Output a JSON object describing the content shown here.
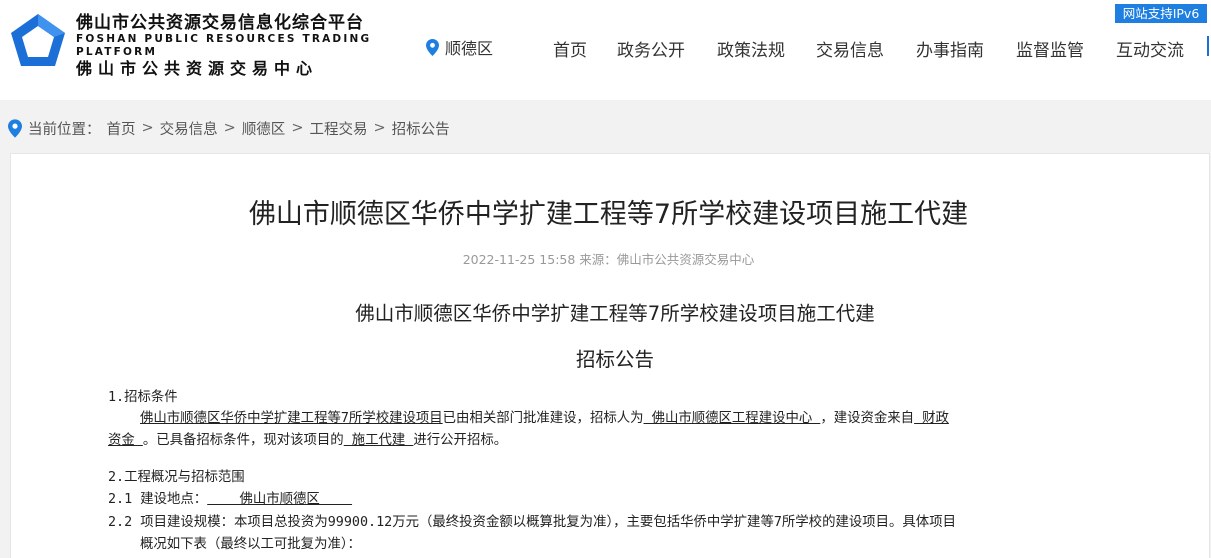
{
  "header": {
    "logo_line1": "佛山市公共资源交易信息化综合平台",
    "logo_line2": "FOSHAN PUBLIC RESOURCES TRADING PLATFORM",
    "logo_line3": "佛山市公共资源交易中心",
    "location": "顺德区",
    "ipv6_badge": "网站支持IPv6",
    "nav": [
      "首页",
      "政务公开",
      "政策法规",
      "交易信息",
      "办事指南",
      "监督监管",
      "互动交流"
    ],
    "colors": {
      "brand": "#1f7fe0",
      "logo": "#1b6fd6"
    }
  },
  "breadcrumb": {
    "prefix": "当前位置：",
    "items": [
      "首页",
      "交易信息",
      "顺德区",
      "工程交易",
      "招标公告"
    ]
  },
  "article": {
    "title": "佛山市顺德区华侨中学扩建工程等7所学校建设项目施工代建",
    "meta": "2022-11-25 15:58 来源：佛山市公共资源交易中心",
    "subtitle": "佛山市顺德区华侨中学扩建工程等7所学校建设项目施工代建",
    "subtitle2": "招标公告",
    "s1_heading": "1.招标条件",
    "s1_l1_a": "佛山市顺德区华侨中学扩建工程等7所学校建设项目",
    "s1_l1_b": "已由相关部门批准建设，招标人为",
    "s1_l1_c": " 佛山市顺德区工程建设中心 ",
    "s1_l1_d": "，建设资金来自",
    "s1_l1_e": " 财政",
    "s1_l2_a": "资金 ",
    "s1_l2_b": "。已具备招标条件，现对该项目的",
    "s1_l2_c": " 施工代建 ",
    "s1_l2_d": "进行公开招标。",
    "s2_heading": "2.工程概况与招标范围",
    "s21_label": "2.1 建设地点：",
    "s21_value": "    佛山市顺德区    ",
    "s22_l1": "2.2 项目建设规模：本项目总投资为99900.12万元（最终投资金额以概算批复为准），主要包括华侨中学扩建等7所学校的建设项目。具体项目",
    "s22_l2": "概况如下表（最终以工可批复为准）："
  }
}
